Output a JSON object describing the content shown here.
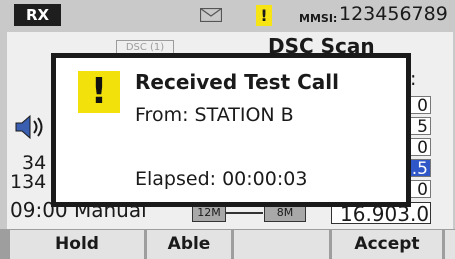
{
  "status_bar": {
    "rx_label": "RX",
    "mmsi_label": "MMSI:",
    "mmsi_value": "123456789",
    "envelope_icon": "envelope-icon",
    "alert_icon": "exclamation-icon"
  },
  "background": {
    "dsc_tag": "DSC (1)",
    "scan_title": "DSC Scan",
    "speaker_icon": "speaker-icon",
    "left_values": [
      "34",
      "134"
    ],
    "right_boxes": [
      "0",
      "5",
      "0",
      ".5",
      "0"
    ],
    "time_mode": "09:00 Manual",
    "scale_12m": "12M",
    "scale_8m": "8M",
    "frequency": "16.903.0"
  },
  "dialog": {
    "title": "Received Test Call",
    "from_text": "From: STATION B",
    "elapsed_text": "Elapsed: 00:00:03",
    "icon": "exclamation-icon"
  },
  "softkeys": [
    {
      "label": "Hold"
    },
    {
      "label": "Able"
    },
    {
      "label": ""
    },
    {
      "label": "Accept"
    },
    {
      "label": ""
    }
  ],
  "colors": {
    "alert_yellow": "#f3e10b",
    "highlight_blue": "#2f57c8",
    "frame_dark": "#1a1a1a"
  }
}
